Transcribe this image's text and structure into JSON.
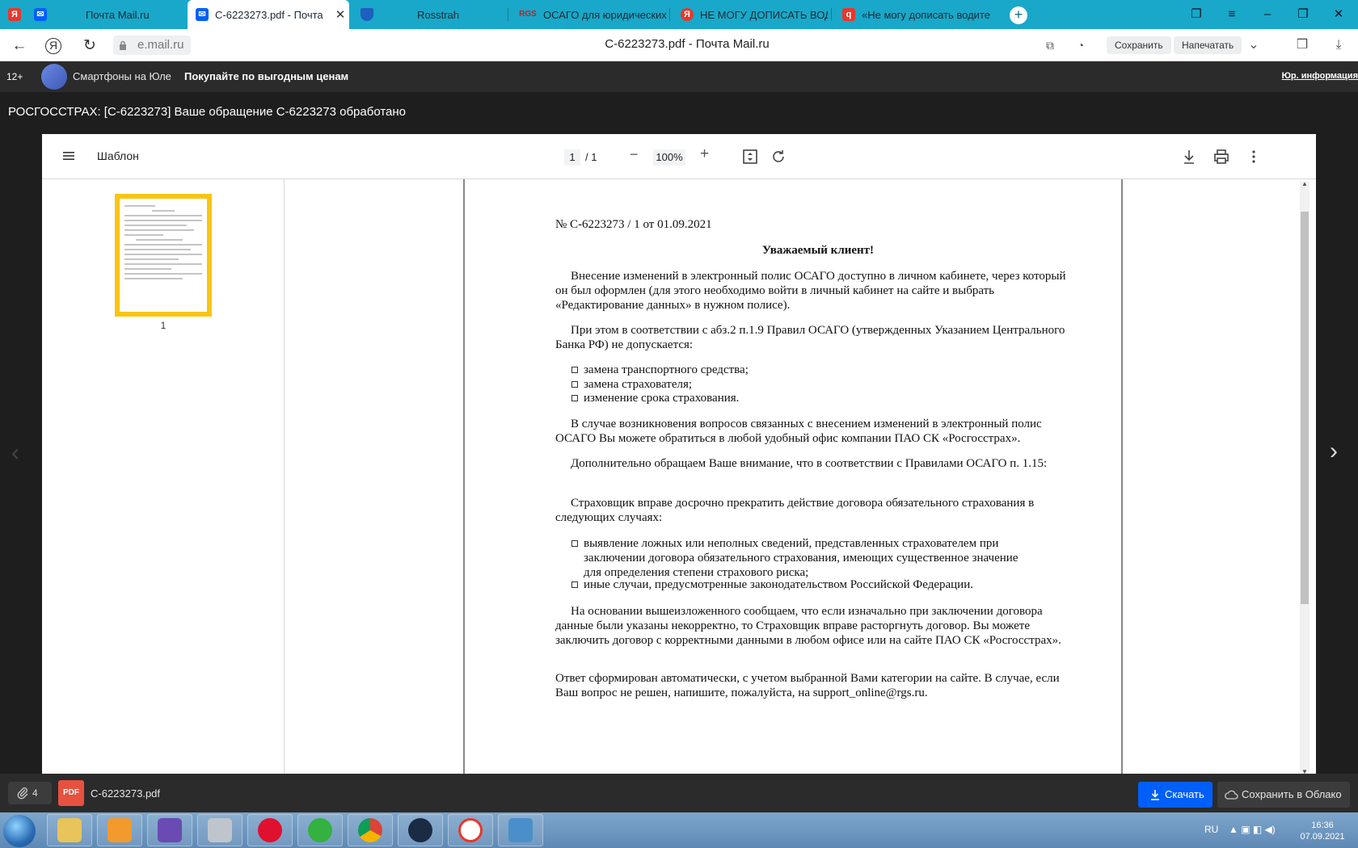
{
  "browser": {
    "tabs": [
      {
        "label": "",
        "icon": "yandex-icon",
        "color": "#e8372c"
      },
      {
        "label": "Почта Mail.ru",
        "icon": "mail-icon",
        "color": "#005ff9"
      },
      {
        "label": "C-6223273.pdf - Почта",
        "icon": "mail-icon",
        "color": "#005ff9"
      },
      {
        "label": "Rosstrah",
        "icon": "shield-icon",
        "color": "#1e5fbf"
      },
      {
        "label": "ОСАГО для юридических",
        "icon": "rgs-icon",
        "color": "#b8232f"
      },
      {
        "label": "НЕ МОГУ ДОПИСАТЬ ВОД",
        "icon": "yandex-icon",
        "color": "#e8372c"
      },
      {
        "label": "«Не могу дописать водите",
        "icon": "yandex-q-icon",
        "color": "#e8372c"
      }
    ],
    "url": "e.mail.ru",
    "page_title": "C-6223273.pdf - Почта Mail.ru",
    "save_label": "Сохранить",
    "print_label": "Напечатать"
  },
  "ad": {
    "age": "12+",
    "text1": "Смартфоны на Юле",
    "text2": "Покупайте по выгодным ценам",
    "info": "Юр. информация"
  },
  "mail": {
    "subject": "РОСГОССТРАХ: [C-6223273] Ваше обращение C-6223273 обработано"
  },
  "viewer": {
    "title": "Шаблон",
    "page_current": "1",
    "page_total": "/ 1",
    "zoom": "100%",
    "thumb_label": "1"
  },
  "document": {
    "number": "№ C-6223273 / 1 от 01.09.2021",
    "greeting": "Уважаемый клиент!",
    "p1": "Внесение изменений в электронный полис ОСАГО доступно в личном кабинете, через который он был оформлен (для этого необходимо войти в личный кабинет на сайте и выбрать «Редактирование данных» в нужном полисе).",
    "p2": "При этом в соответствии с абз.2 п.1.9 Правил ОСАГО (утвержденных Указанием Центрального Банка РФ) не допускается:",
    "list1": [
      "замена транспортного средства;",
      "замена страхователя;",
      "изменение срока страхования."
    ],
    "p3": "В случае возникновения вопросов связанных с внесением изменений в электронный полис ОСАГО Вы можете обратиться в любой удобный офис компании ПАО СК «Росгосстрах».",
    "p4": "Дополнительно обращаем Ваше внимание, что в соответствии с Правилами ОСАГО п. 1.15:",
    "p5": "Страховщик вправе досрочно прекратить действие договора обязательного страхования в следующих случаях:",
    "list2": [
      "выявление ложных или неполных сведений, представленных страхователем при заключении договора обязательного страхования, имеющих существенное значение для определения степени страхового риска;",
      "иные случаи, предусмотренные законодательством Российской Федерации."
    ],
    "p6": "На основании вышеизложенного сообщаем, что если изначально при заключении договора данные были указаны некорректно, то Страховщик вправе расторгнуть договор. Вы можете заключить договор с корректными данными в любом офисе или на сайте ПАО СК «Росгосстрах».",
    "p7": "Ответ сформирован автоматически, с учетом выбранной Вами категории на сайте. В случае, если Ваш вопрос не решен, напишите, пожалуйста, на support_online@rgs.ru."
  },
  "attachments": {
    "count": "4",
    "type": "PDF",
    "filename": "C-6223273.pdf",
    "download_label": "Скачать",
    "cloud_label": "Сохранить в Облако"
  },
  "taskbar": {
    "lang": "RU",
    "time": "16:36",
    "date": "07.09.2021"
  }
}
